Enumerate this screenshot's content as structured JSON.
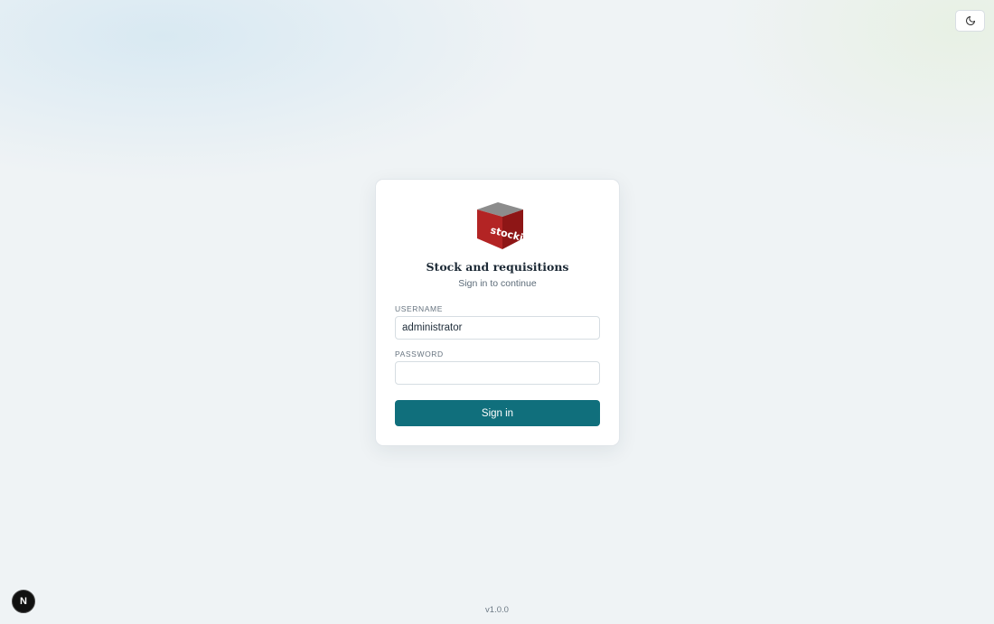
{
  "header": {
    "theme_toggle_icon": "moon-icon"
  },
  "login": {
    "logo_text": "stockie",
    "title": "Stock and requisitions",
    "subtitle": "Sign in to continue",
    "username_label": "USERNAME",
    "username_value": "administrator",
    "password_label": "PASSWORD",
    "password_value": "",
    "submit_label": "Sign in"
  },
  "footer": {
    "version": "v1.0.0",
    "dev_badge": "N"
  },
  "colors": {
    "accent": "#106f7c",
    "logo_red": "#a11d1d",
    "background": "#eff3f5"
  }
}
